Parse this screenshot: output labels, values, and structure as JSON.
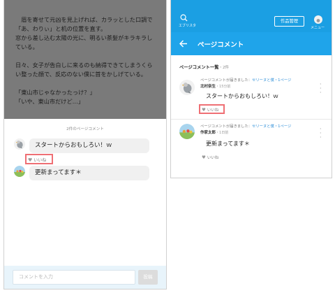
{
  "left": {
    "story_lines": [
      "　眉を寄せて元凶を見上げれば、カラッとした口調で",
      "「あ、わりぃ」と机の位置を直す。",
      "窓から差し込む太陽の光に、明るい茶髪がキラキラし",
      "ている。",
      "",
      "日々、女子が告白しに来るのも納得できてしまうくら",
      "い整った顔で、反応のない僕に首をかしげている。",
      "",
      "「東山市じゃなかったっけ？」",
      "「いや、東山市だけど…」"
    ],
    "comment_count_label": "2件のページコメント",
    "comments": [
      {
        "text": "スタートからおもしろい！ｗ",
        "like_label": "いいね"
      },
      {
        "text": "更新まってます＊",
        "like_label": "いいね"
      }
    ],
    "input_placeholder": "コメントを入力",
    "post_label": "投稿"
  },
  "right": {
    "brand": "エブリスタ",
    "manage_label": "作品管理",
    "menu_label": "メニュー",
    "page_title": "ページコメント",
    "list_title": "ページコメント一覧",
    "list_count": "・2件",
    "comments": [
      {
        "meta_prefix": "ページコメントが届きました：",
        "meta_link": "セリーヌと僕・1ページ",
        "author": "北村奈生",
        "time": "・15分前",
        "text": "スタートからおもしろい！ｗ",
        "like_label": "いいね"
      },
      {
        "meta_prefix": "ページコメントが届きました：",
        "meta_link": "セリーヌと僕・1ページ",
        "author": "作家太郎",
        "time": "・1日前",
        "text": "更新まってます＊",
        "like_label": "いいね"
      }
    ]
  },
  "colors": {
    "accent": "#1b9fe3",
    "highlight": "#ef6f74",
    "link": "#2f8fd8"
  }
}
